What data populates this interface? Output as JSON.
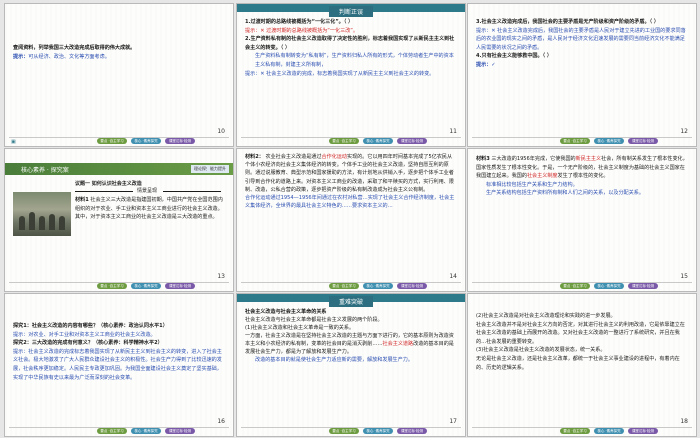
{
  "footer": {
    "btn1": "要点 ·自主学习",
    "btn2": "核心 ·素养探究",
    "btn3": "课堂达标·检测"
  },
  "slides": {
    "s10": {
      "num": "10",
      "q": "查阅资料，列举我国三大改造完成后取得的伟大成就。",
      "a_label": "提示：",
      "a_text": "可从经济、政治、文化等方面考虑。"
    },
    "s11": {
      "num": "11",
      "banner": "判断正误",
      "l1": "1.过渡时期的总路线被概括为“一化三化”。（    ）",
      "l1_ans": "提示：✕   过渡时期的总路线被概括为“一化三改”。",
      "l2": "2.生产资料私有制的社会主义改造取得了决定性的胜利，标志着我国实现了从新民主主义到社会主义的转变。（    ）",
      "l2_ans": "提示：✕   社会主义改造的完成，标志着我国实现了从新民主主义到社会主义的转变。",
      "l3_a": "生产资料私有制转变为“私有制”，生产资料归私人所有的形式，个体劳动者生产中的资本主义私有制，封建主义所有制，",
      "l3_b": "要求说的资本主义的转变工作……"
    },
    "s12": {
      "num": "12",
      "l3": "3.社会主义改造完成后，我国社会的主要矛盾是无产阶级和资产阶级的矛盾。（    ）",
      "l3_ans": "提示：✕   社会主义改造完成后，我国社会的主要矛盾是人民对于建立先进的工业国的要求同落后的农业国的现实之间的矛盾，是人民对于经济文化迅速发展的需要同当前经济文化不能满足人民需要的状况之间的矛盾。",
      "l4": "4.只有社会主义能够救中国。（    ）",
      "l4_ans": "提示：✓"
    },
    "s13": {
      "num": "13",
      "section": "核心素养 · 探究案",
      "tag1": "理论探究",
      "tag2": "能力提升",
      "topic": "议题一  如何认识社会主义改造",
      "sub": "情景呈现",
      "m_label": "材料1",
      "m_text": "社会主义三大改造是指建国初期，中国共产党在全国范围内组织的对于农业、手工业和资本主义工商业进行的社会主义改造。其中，对于资本主义工商业的社会主义改造是三大改造的重点。"
    },
    "s14": {
      "num": "14",
      "m_label": "材料2：",
      "intro": "农业社会主义改造是通过",
      "hl": "合作化运动",
      "body": "实现的。它以用四年时间基本完成了5亿农民从个体小农经济向社会主义集体经济的转变。个体手工业的社会主义改造，坚持自愿互利的原则。通过说服教育、典型示范和国家援助的方法，有计划地从供销入手，逐步把个体手工业者引导到合作化的道路上来。对资本主义工商业的改造，采取了和平赎买的方式，实行利用、限制、改造，公私合营的政策，逐步把资产阶级的私有制改造成为社会主义公有制。",
      "hl2": "合作化运动通过1954—1956年间通过在农村对私营…实现了社会主义合作经济制度，社会主义集体经济，全世界的最具社会主义特色的……要求资本主义的…"
    },
    "s15": {
      "num": "15",
      "m_label": "材料3",
      "intro": "三大改造的1956年完成，它使我国的",
      "hl": "新民主主义",
      "body": "社会，所有制关系发生了根本性变化，国家性质发生了根本性变化。于是，一个无产阶级的，社会主义制度为基础的社会主义国家在我国建立起来。我国的",
      "hl2": "社会主义制度",
      "tail": "发生了根本性的变化。",
      "note1": "标准相比较包括生产关系和生产力结构。",
      "note2": "生产关系结构包括生产资料所有制和人们之间的关系，以及分配关系。"
    },
    "s16": {
      "num": "16",
      "q1": "探究1：社会主义改造的内容有哪些？（核心素养：政治认同水平1）",
      "a1": "提示：对农业、对手工业和对资本主义工商业的社会主义改造。",
      "q2": "探究2：三大改造的完成有何意义？（核心素养：科学精神水平2）",
      "a2": "提示：社会主义改造的完成标志着我国实现了从新民主主义到社会主义的转变，进入了社会主义社会。极大地激发了广大人民群众建设社会主义的积极性。社会生产力得到了比较迅速的发展，社会秩序更加稳定。人民民主专政更加巩固。为我国全面建设社会主义奠定了坚实基础，实现了中华民族有史以来最为广泛而深刻的社会变革。"
    },
    "s17": {
      "num": "17",
      "banner": "重难突破",
      "h": "社会主义改造与社会主义革命的关系",
      "t1": "社会主义改造与社会主义革命都是社会主义发展的两个阶段。",
      "t2": "(1)社会主义改造和社会主义革命是一致的关系。",
      "t3": "一方面，社会主义改造是在坚持社会主义改造的主题与方面下进行的，它的基本原则为改造资本主义和小农经济的私有制，变革的社会目的是消灭剥削……",
      "hl": "社会主义道路",
      "t4": "改造的基本目的是发展社会生产力，都是为了解放和发展生产力。",
      "note": "改造的基本目的就是使社会生产力适应新的需要，解放和发展生产力。"
    },
    "s18": {
      "num": "18",
      "l1": "(2)社会主义改造是对社会主义改造理论和实践的进一步发展。",
      "l2": "社会主义改造并不是对社会主义方向的否定，对其进行社会主义的利用改造，它是依靠建立在社会主义改造的基础上而展开的改造。又对社会主义改造的一整进行了系统研究，并且在我的…社会发展的重要转变。",
      "l3": "(3)社会主义改造是社会主义改造的发展状态，统一关系。",
      "l4": "无论是社会主义改造，还是社会主义改革，都统一于社会主义事业建设的进程中，有着内在的、历史的逻辑关系。"
    }
  }
}
